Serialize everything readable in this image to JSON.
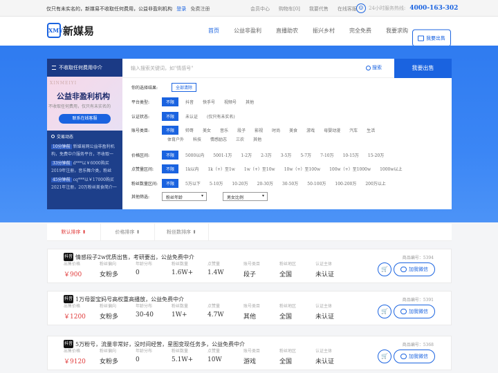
{
  "topbar": {
    "notice": "仅只有未实名的，新媒易不收取任何费用，公益非盈利机构",
    "login": "登录",
    "register": "免费注册",
    "links": [
      "会员中心",
      "购物车[0]",
      "我要代售",
      "在线客服"
    ],
    "hotline_label": "24小时服务热线:",
    "hotline_number": "4000-163-302"
  },
  "nav": {
    "logo_mark": "XMY",
    "logo_text": "新媒易",
    "links": [
      "首页",
      "公益非盈利",
      "直播助农",
      "振兴乡村",
      "完全免费",
      "我要求购"
    ],
    "sell_button": "我要出售"
  },
  "sidebar": {
    "header": "不收取任何费用中介",
    "promo_sub": "XINMEIYI",
    "promo_title": "公益非盈利机构",
    "promo_desc": "不收取任何费用，仅只有未实名的",
    "promo_cta": "联系在线客服",
    "dynamics_title": "交易动态",
    "dynamics": [
      {
        "tag": "10分钟前",
        "text": "新媒易网公益非盈利机构，免费中介服务平台，不收取一"
      },
      {
        "tag": "33分钟前",
        "text": "d***以￥6000购买2019年注册，音乐舞介类，粉丝"
      },
      {
        "tag": "45分钟前",
        "text": "cq***以￥17000购买2021年注册，20万粉丝美食简介一"
      }
    ]
  },
  "search": {
    "placeholder": "输入搜索关键词，如\"情感号\"",
    "button": "搜索",
    "sell_button": "我要出售"
  },
  "filters": {
    "selected_label": "你的选择结果:",
    "clear_all": "全部清除",
    "rows": [
      {
        "label": "平台类型:",
        "selected": "不限",
        "options": [
          "抖音",
          "快手号",
          "视频号",
          "其他"
        ]
      },
      {
        "label": "认证状态:",
        "selected": "不限",
        "options": [
          "未认证",
          "(仅只有未实名)"
        ]
      },
      {
        "label": "账号类目:",
        "selected": "不限",
        "options": [
          "帅哥",
          "美女",
          "音乐",
          "段子",
          "影视",
          "时尚",
          "美食",
          "游戏",
          "母婴动漫",
          "汽车",
          "生活"
        ]
      },
      {
        "label": "",
        "selected": "",
        "options": [
          "体育户外",
          "科技",
          "情感励志",
          "三农",
          "其他"
        ]
      },
      {
        "label": "价格区间:",
        "selected": "不限",
        "options": [
          "5000以内",
          "5001-1万",
          "1-2万",
          "2-3万",
          "3-5万",
          "5-7万",
          "7-10万",
          "10-15万",
          "15-20万"
        ]
      },
      {
        "label": "点赞量区间:",
        "selected": "不限",
        "options": [
          "1k以内",
          "1k（+）至1w",
          "1w（+）至10w",
          "10w（+）至100w",
          "100w（+）至1000w",
          "1000w以上"
        ]
      },
      {
        "label": "粉丝数量区间:",
        "selected": "不限",
        "options": [
          "5万以下",
          "5-10万",
          "10-20万",
          "20-30万",
          "30-50万",
          "50-100万",
          "100-200万",
          "200万以上"
        ]
      }
    ],
    "other_label": "其他筛选:",
    "dropdowns": [
      "粉丝年龄",
      "男女比例"
    ]
  },
  "sort": [
    "默认排序 ⬆",
    "价格排序 ⬆",
    "粉丝数排序 ⬆"
  ],
  "listing_labels": {
    "platform": "抖音",
    "id_prefix": "商品编号：",
    "cols": [
      "出售价格",
      "粉丝偏向",
      "年龄分布",
      "粉丝数量",
      "点赞量",
      "账号类目",
      "粉丝地区",
      "认证主体"
    ],
    "wechat": "加我微信"
  },
  "listings": [
    {
      "title": "情感段子2w优质出售，考研要出，公益免费中介",
      "no": "5394",
      "values": [
        "￥900",
        "女粉多",
        "0",
        "1.6W+",
        "1.4W",
        "段子",
        "全国",
        "未认证"
      ]
    },
    {
      "title": "1万母婴宝妈号高权重高播放，公益免费中介",
      "no": "5391",
      "values": [
        "￥1200",
        "女粉多",
        "30-40",
        "1W+",
        "4.7W",
        "其他",
        "全国",
        "未认证"
      ]
    },
    {
      "title": "5万粉号，流量非常好，没时间经营，星图变现任务多，公益免费中介",
      "no": "5368",
      "values": [
        "￥9120",
        "女粉多",
        "0",
        "5.1W+",
        "10W",
        "游戏",
        "全国",
        "未认证"
      ]
    }
  ]
}
